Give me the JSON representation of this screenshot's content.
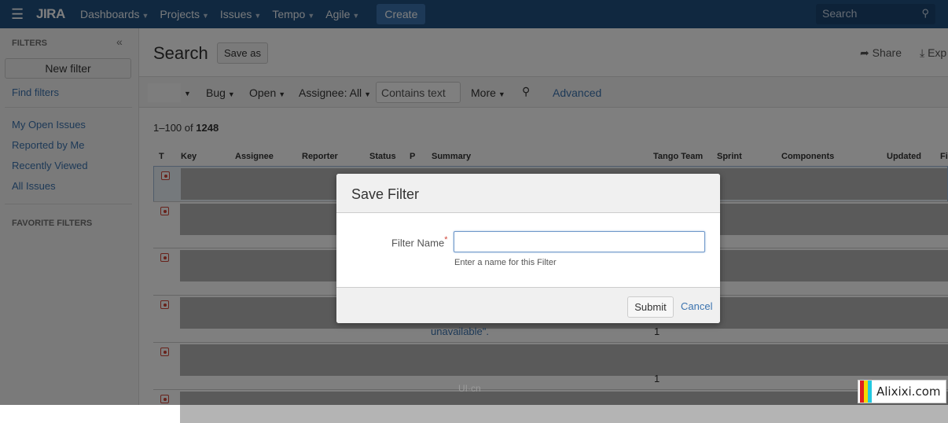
{
  "nav": {
    "logo": "JIRA",
    "items": [
      "Dashboards",
      "Projects",
      "Issues",
      "Tempo",
      "Agile"
    ],
    "create": "Create",
    "search_placeholder": "Search"
  },
  "sidebar": {
    "header": "FILTERS",
    "new_filter": "New filter",
    "find_filters": "Find filters",
    "links": [
      "My Open Issues",
      "Reported by Me",
      "Recently Viewed",
      "All Issues"
    ],
    "favorites": "FAVORITE FILTERS"
  },
  "main": {
    "title": "Search",
    "save_as": "Save as",
    "share": "Share",
    "export": "Exp",
    "filters": {
      "bug": "Bug",
      "open": "Open",
      "assignee": "Assignee: All",
      "contains_placeholder": "Contains text",
      "more": "More",
      "advanced": "Advanced"
    },
    "count": {
      "range": "1–100",
      "of": "of",
      "total": "1248"
    },
    "columns": [
      "T",
      "Key",
      "Assignee",
      "Reporter",
      "Status",
      "P",
      "Summary",
      "Tango Team",
      "Sprint",
      "Components",
      "Updated",
      "Fi"
    ],
    "row_texts": {
      "summary_fragment": "unavailable\".",
      "team_value": "1"
    }
  },
  "dialog": {
    "title": "Save Filter",
    "label": "Filter Name",
    "required": "*",
    "value": "",
    "hint": "Enter a name for this Filter",
    "submit": "Submit",
    "cancel": "Cancel"
  },
  "watermarks": {
    "uicn": "UI·cn",
    "alixixi": "Alixixi.com"
  },
  "colors": {
    "nav": "#205081",
    "link": "#3b73af",
    "issue_type": "#d04437"
  }
}
